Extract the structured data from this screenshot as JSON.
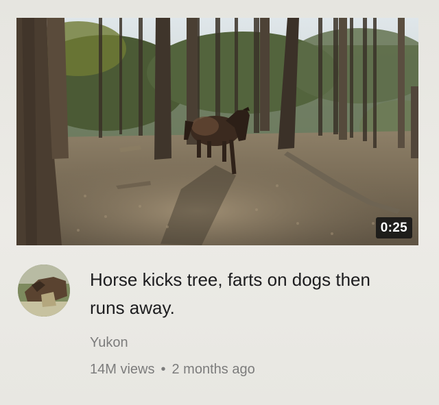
{
  "video": {
    "duration": "0:25",
    "title": "Horse kicks tree, farts on dogs then runs away.",
    "channel": "Yukon",
    "views": "14M views",
    "separator": "•",
    "age": "2 months ago"
  },
  "colors": {
    "background": "#e6e5e0",
    "title_text": "#1d1d1f",
    "meta_text": "#7c7c7c",
    "duration_badge": "#141414"
  }
}
